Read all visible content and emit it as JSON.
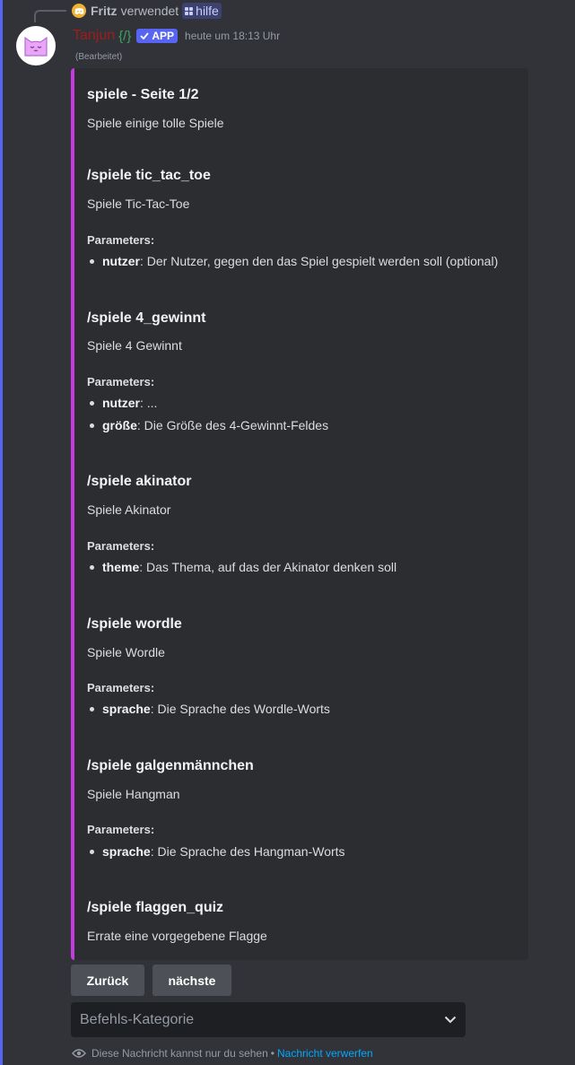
{
  "reply": {
    "user": "Fritz",
    "verb": "verwendet",
    "command": "hilfe"
  },
  "message": {
    "author": "Tanjun",
    "tag": "{/}",
    "badge": "APP",
    "timestamp": "heute um 18:13 Uhr",
    "edited": "(Bearbeitet)"
  },
  "embed": {
    "accent_color": "#c33cde",
    "title": "spiele - Seite 1/2",
    "description": "Spiele einige tolle Spiele",
    "commands": [
      {
        "name": "/spiele tic_tac_toe",
        "description": "Spiele Tic-Tac-Toe",
        "parameters_label": "Parameters:",
        "params": [
          {
            "name": "nutzer",
            "desc": ": Der Nutzer, gegen den das Spiel gespielt werden soll (optional)"
          }
        ]
      },
      {
        "name": "/spiele 4_gewinnt",
        "description": "Spiele 4 Gewinnt",
        "parameters_label": "Parameters:",
        "params": [
          {
            "name": "nutzer",
            "desc": ": ..."
          },
          {
            "name": "größe",
            "desc": ": Die Größe des 4-Gewinnt-Feldes"
          }
        ]
      },
      {
        "name": "/spiele akinator",
        "description": "Spiele Akinator",
        "parameters_label": "Parameters:",
        "params": [
          {
            "name": "theme",
            "desc": ": Das Thema, auf das der Akinator denken soll"
          }
        ]
      },
      {
        "name": "/spiele wordle",
        "description": "Spiele Wordle",
        "parameters_label": "Parameters:",
        "params": [
          {
            "name": "sprache",
            "desc": ": Die Sprache des Wordle-Worts"
          }
        ]
      },
      {
        "name": "/spiele galgenmännchen",
        "description": "Spiele Hangman",
        "parameters_label": "Parameters:",
        "params": [
          {
            "name": "sprache",
            "desc": ": Die Sprache des Hangman-Worts"
          }
        ]
      },
      {
        "name": "/spiele flaggen_quiz",
        "description": "Errate eine vorgegebene Flagge"
      }
    ]
  },
  "buttons": {
    "back": "Zurück",
    "next": "nächste"
  },
  "select": {
    "placeholder": "Befehls-Kategorie"
  },
  "footer": {
    "notice": "Diese Nachricht kannst nur du sehen",
    "separator": "•",
    "dismiss": "Nachricht verwerfen"
  },
  "icons": {
    "reply_app_icon": "discord-logo-icon",
    "avatar": "cat-face-icon",
    "verified": "checkmark-icon",
    "command": "slash-command-icon",
    "select_arrow": "chevron-down-icon",
    "ephemeral": "eye-icon"
  }
}
